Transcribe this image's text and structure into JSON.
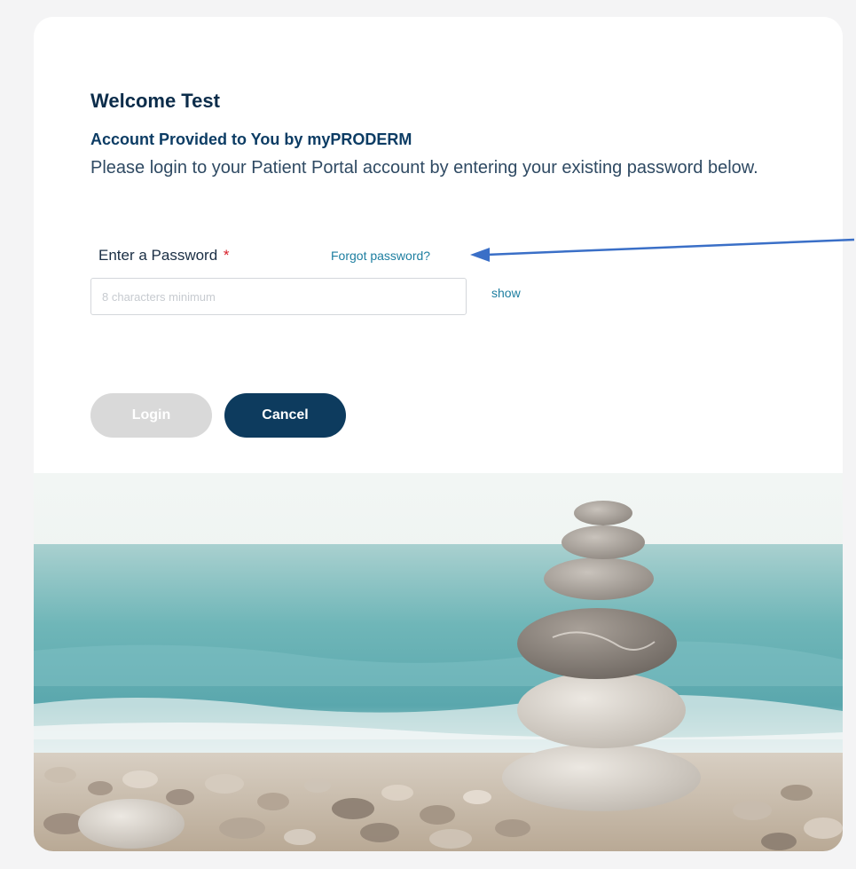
{
  "page": {
    "title": "Welcome Test",
    "subtitle": "Account Provided to You by myPRODERM",
    "description": "Please login to your Patient Portal account by entering your existing password below."
  },
  "password": {
    "label": "Enter a Password",
    "required_marker": "*",
    "forgot_link": "Forgot password?",
    "placeholder": "8 characters minimum",
    "value": "",
    "show_toggle": "show"
  },
  "buttons": {
    "login": "Login",
    "cancel": "Cancel"
  },
  "colors": {
    "brand_navy": "#0d3b5e",
    "link_teal": "#1d7ea0",
    "disabled_gray": "#d9d9d9",
    "required_red": "#d8202a",
    "annotation_arrow": "#3a6fc7"
  },
  "image": {
    "subject": "stacked stones on pebble beach with sea background"
  }
}
